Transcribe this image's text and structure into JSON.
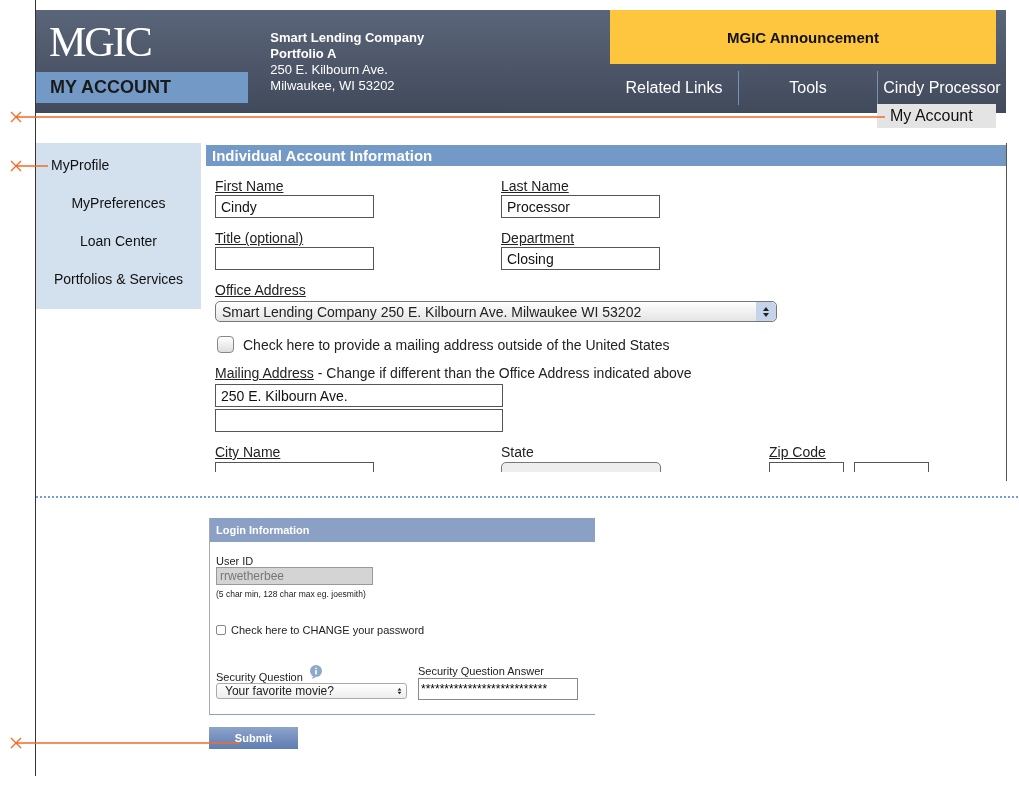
{
  "header": {
    "logo": "MGIC",
    "section_title": "MY ACCOUNT",
    "company": [
      "Smart Lending Company",
      "Portfolio A",
      "250 E. Kilbourn Ave.",
      "Milwaukee, WI 53202"
    ],
    "announcement": "MGIC Announcement",
    "nav": [
      {
        "label": "Related Links"
      },
      {
        "label": "Tools"
      },
      {
        "label": "Cindy Processor"
      }
    ],
    "user_menu": [
      "My Account"
    ]
  },
  "sidebar": {
    "items": [
      {
        "label": "MyProfile",
        "kind": "left"
      },
      {
        "label": "MyPreferences",
        "kind": "center"
      },
      {
        "label": "Loan Center",
        "kind": "center"
      },
      {
        "label": "Portfolios & Services",
        "kind": "center"
      }
    ]
  },
  "account_info": {
    "title": "Individual Account Information",
    "first_name": {
      "label": "First Name",
      "underlined": true,
      "value": "Cindy"
    },
    "last_name": {
      "label": "Last Name",
      "underlined": true,
      "value": "Processor"
    },
    "title_field": {
      "label": "Title (optional)",
      "underlined": true
    },
    "department": {
      "label": "Department",
      "underlined": true,
      "value": "Closing"
    },
    "office_address": {
      "label": "Office Address",
      "underlined": true,
      "value": "Smart Lending Company 250 E. Kilbourn Ave. Milwaukee WI 53202"
    },
    "outside_us": {
      "label": "Check here to provide a mailing address outside of the United States",
      "checked": false
    },
    "mailing_address": {
      "label": "Mailing Address",
      "underlined": true,
      "note": " - Change if different than the Office Address indicated above",
      "value": "250 E. Kilbourn Ave."
    },
    "city": {
      "label": "City Name",
      "underlined": true
    },
    "state": {
      "label": "State",
      "underlined": false
    },
    "zip": {
      "label": "Zip Code",
      "underlined": true
    }
  },
  "login": {
    "title": "Login Information",
    "user_id": {
      "label": "User ID",
      "value": "rrwetherbee",
      "disabled": true,
      "hint": "(5 char min, 128 char max eg. joesmith)"
    },
    "change_password": {
      "label": "Check here to CHANGE your password",
      "checked": false
    },
    "security_question": {
      "label": "Security Question",
      "value": "Your favorite movie?"
    },
    "security_answer": {
      "label": "Security Question Answer",
      "value": "***************************"
    }
  },
  "submit": "Submit"
}
